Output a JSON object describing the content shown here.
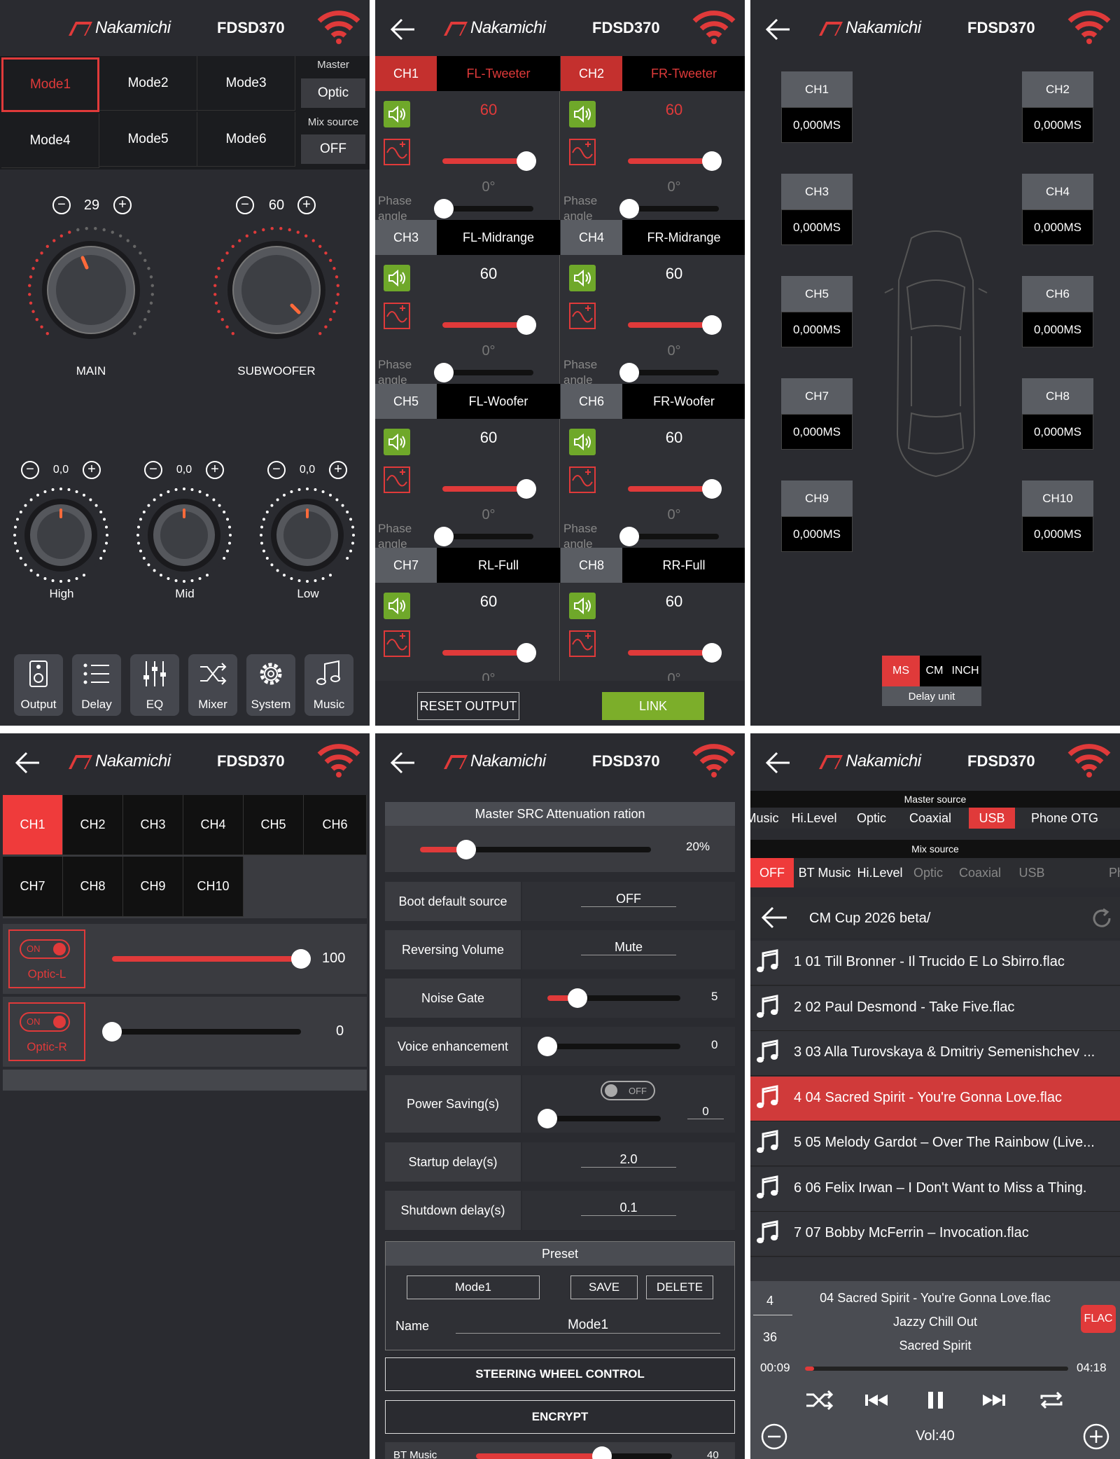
{
  "brand": "Nakamichi",
  "model": "FDSD370",
  "panel1": {
    "modes": [
      "Mode1",
      "Mode2",
      "Mode3",
      "Mode4",
      "Mode5",
      "Mode6"
    ],
    "master_label": "Master",
    "master_value": "Optic",
    "mix_label": "Mix source",
    "mix_value": "OFF",
    "main": {
      "value": "29",
      "label": "MAIN"
    },
    "sub": {
      "value": "60",
      "label": "SUBWOOFER"
    },
    "high": {
      "value": "0,0",
      "label": "High"
    },
    "mid": {
      "value": "0,0",
      "label": "Mid"
    },
    "low": {
      "value": "0,0",
      "label": "Low"
    },
    "nav": [
      {
        "label": "Output",
        "icon": "speaker-icon"
      },
      {
        "label": "Delay",
        "icon": "list-icon"
      },
      {
        "label": "EQ",
        "icon": "sliders-icon"
      },
      {
        "label": "Mixer",
        "icon": "shuffle-icon"
      },
      {
        "label": "System",
        "icon": "gear-icon"
      },
      {
        "label": "Music",
        "icon": "music-icon"
      }
    ]
  },
  "panel2": {
    "channels": [
      {
        "ch": "CH1",
        "name": "FL-Tweeter",
        "value": "60",
        "phase": "0°",
        "active": true
      },
      {
        "ch": "CH2",
        "name": "FR-Tweeter",
        "value": "60",
        "phase": "0°",
        "active": true
      },
      {
        "ch": "CH3",
        "name": "FL-Midrange",
        "value": "60",
        "phase": "0°",
        "active": false
      },
      {
        "ch": "CH4",
        "name": "FR-Midrange",
        "value": "60",
        "phase": "0°",
        "active": false
      },
      {
        "ch": "CH5",
        "name": "FL-Woofer",
        "value": "60",
        "phase": "0°",
        "active": false
      },
      {
        "ch": "CH6",
        "name": "FR-Woofer",
        "value": "60",
        "phase": "0°",
        "active": false
      },
      {
        "ch": "CH7",
        "name": "RL-Full",
        "value": "60",
        "phase": "0°",
        "active": false
      },
      {
        "ch": "CH8",
        "name": "RR-Full",
        "value": "60",
        "phase": "0°",
        "active": false
      }
    ],
    "phase_label_1": "Phase",
    "phase_label_2": "angle",
    "reset_label": "RESET OUTPUT",
    "link_label": "LINK"
  },
  "panel3": {
    "delays": [
      {
        "ch": "CH1",
        "value": "0,000MS"
      },
      {
        "ch": "CH2",
        "value": "0,000MS"
      },
      {
        "ch": "CH3",
        "value": "0,000MS"
      },
      {
        "ch": "CH4",
        "value": "0,000MS"
      },
      {
        "ch": "CH5",
        "value": "0,000MS"
      },
      {
        "ch": "CH6",
        "value": "0,000MS"
      },
      {
        "ch": "CH7",
        "value": "0,000MS"
      },
      {
        "ch": "CH8",
        "value": "0,000MS"
      },
      {
        "ch": "CH9",
        "value": "0,000MS"
      },
      {
        "ch": "CH10",
        "value": "0,000MS"
      }
    ],
    "units": [
      "MS",
      "CM",
      "INCH"
    ],
    "unit_label": "Delay unit"
  },
  "panel4": {
    "channels": [
      "CH1",
      "CH2",
      "CH3",
      "CH4",
      "CH5",
      "CH6",
      "CH7",
      "CH8",
      "CH9",
      "CH10"
    ],
    "rows": [
      {
        "toggle": "ON",
        "label": "Optic-L",
        "value": "100",
        "level": 1.0
      },
      {
        "toggle": "ON",
        "label": "Optic-R",
        "value": "0",
        "level": 0.0
      }
    ]
  },
  "panel5": {
    "master_title": "Master SRC Attenuation ration",
    "master_value": "20%",
    "master_level": 0.2,
    "boot_label": "Boot default source",
    "boot_value": "OFF",
    "rev_label": "Reversing Volume",
    "rev_value": "Mute",
    "noise_label": "Noise Gate",
    "noise_value": "5",
    "voice_label": "Voice enhancement",
    "voice_value": "0",
    "power_label": "Power Saving(s)",
    "power_toggle": "OFF",
    "power_value": "0",
    "startup_label": "Startup delay(s)",
    "startup_value": "2.0",
    "shutdown_label": "Shutdown delay(s)",
    "shutdown_value": "0.1",
    "preset_title": "Preset",
    "preset_mode": "Mode1",
    "save_label": "SAVE",
    "delete_label": "DELETE",
    "name_label": "Name",
    "name_value": "Mode1",
    "swc_label": "STEERING WHEEL CONTROL",
    "encrypt_label": "ENCRYPT",
    "bt_label": "BT Music",
    "bt_value": "40"
  },
  "panel6": {
    "master_title": "Master source",
    "master_items": [
      "Music",
      "Hi.Level",
      "Optic",
      "Coaxial",
      "USB",
      "Phone OTG"
    ],
    "mix_title": "Mix source",
    "mix_items": [
      "OFF",
      "BT Music",
      "Hi.Level",
      "Optic",
      "Coaxial",
      "USB",
      "Ph"
    ],
    "folder": "CM Cup 2026 beta/",
    "songs": [
      "1 01 Till Bronner - Il Trucido E Lo Sbirro.flac",
      "2 02 Paul Desmond - Take Five.flac",
      "3 03 Alla Turovskaya & Dmitriy Semenishchev ...",
      "4 04 Sacred Spirit - You're Gonna Love.flac",
      "5 05 Melody Gardot – Over The Rainbow (Live...",
      "6 06 Felix Irwan – I Don't Want to Miss a Thing.",
      "7 07 Bobby McFerrin – Invocation.flac"
    ],
    "now_index": "4",
    "now_total": "36",
    "now_title": "04 Sacred Spirit - You're Gonna Love.flac",
    "now_album": "Jazzy Chill Out",
    "now_artist": "Sacred Spirit",
    "format": "FLAC",
    "time_current": "00:09",
    "time_total": "04:18",
    "progress": 0.035,
    "volume": "Vol:40"
  },
  "colors": {
    "accent": "#e03a3a",
    "green": "#7cae2a",
    "panel": "#2a2b30"
  }
}
